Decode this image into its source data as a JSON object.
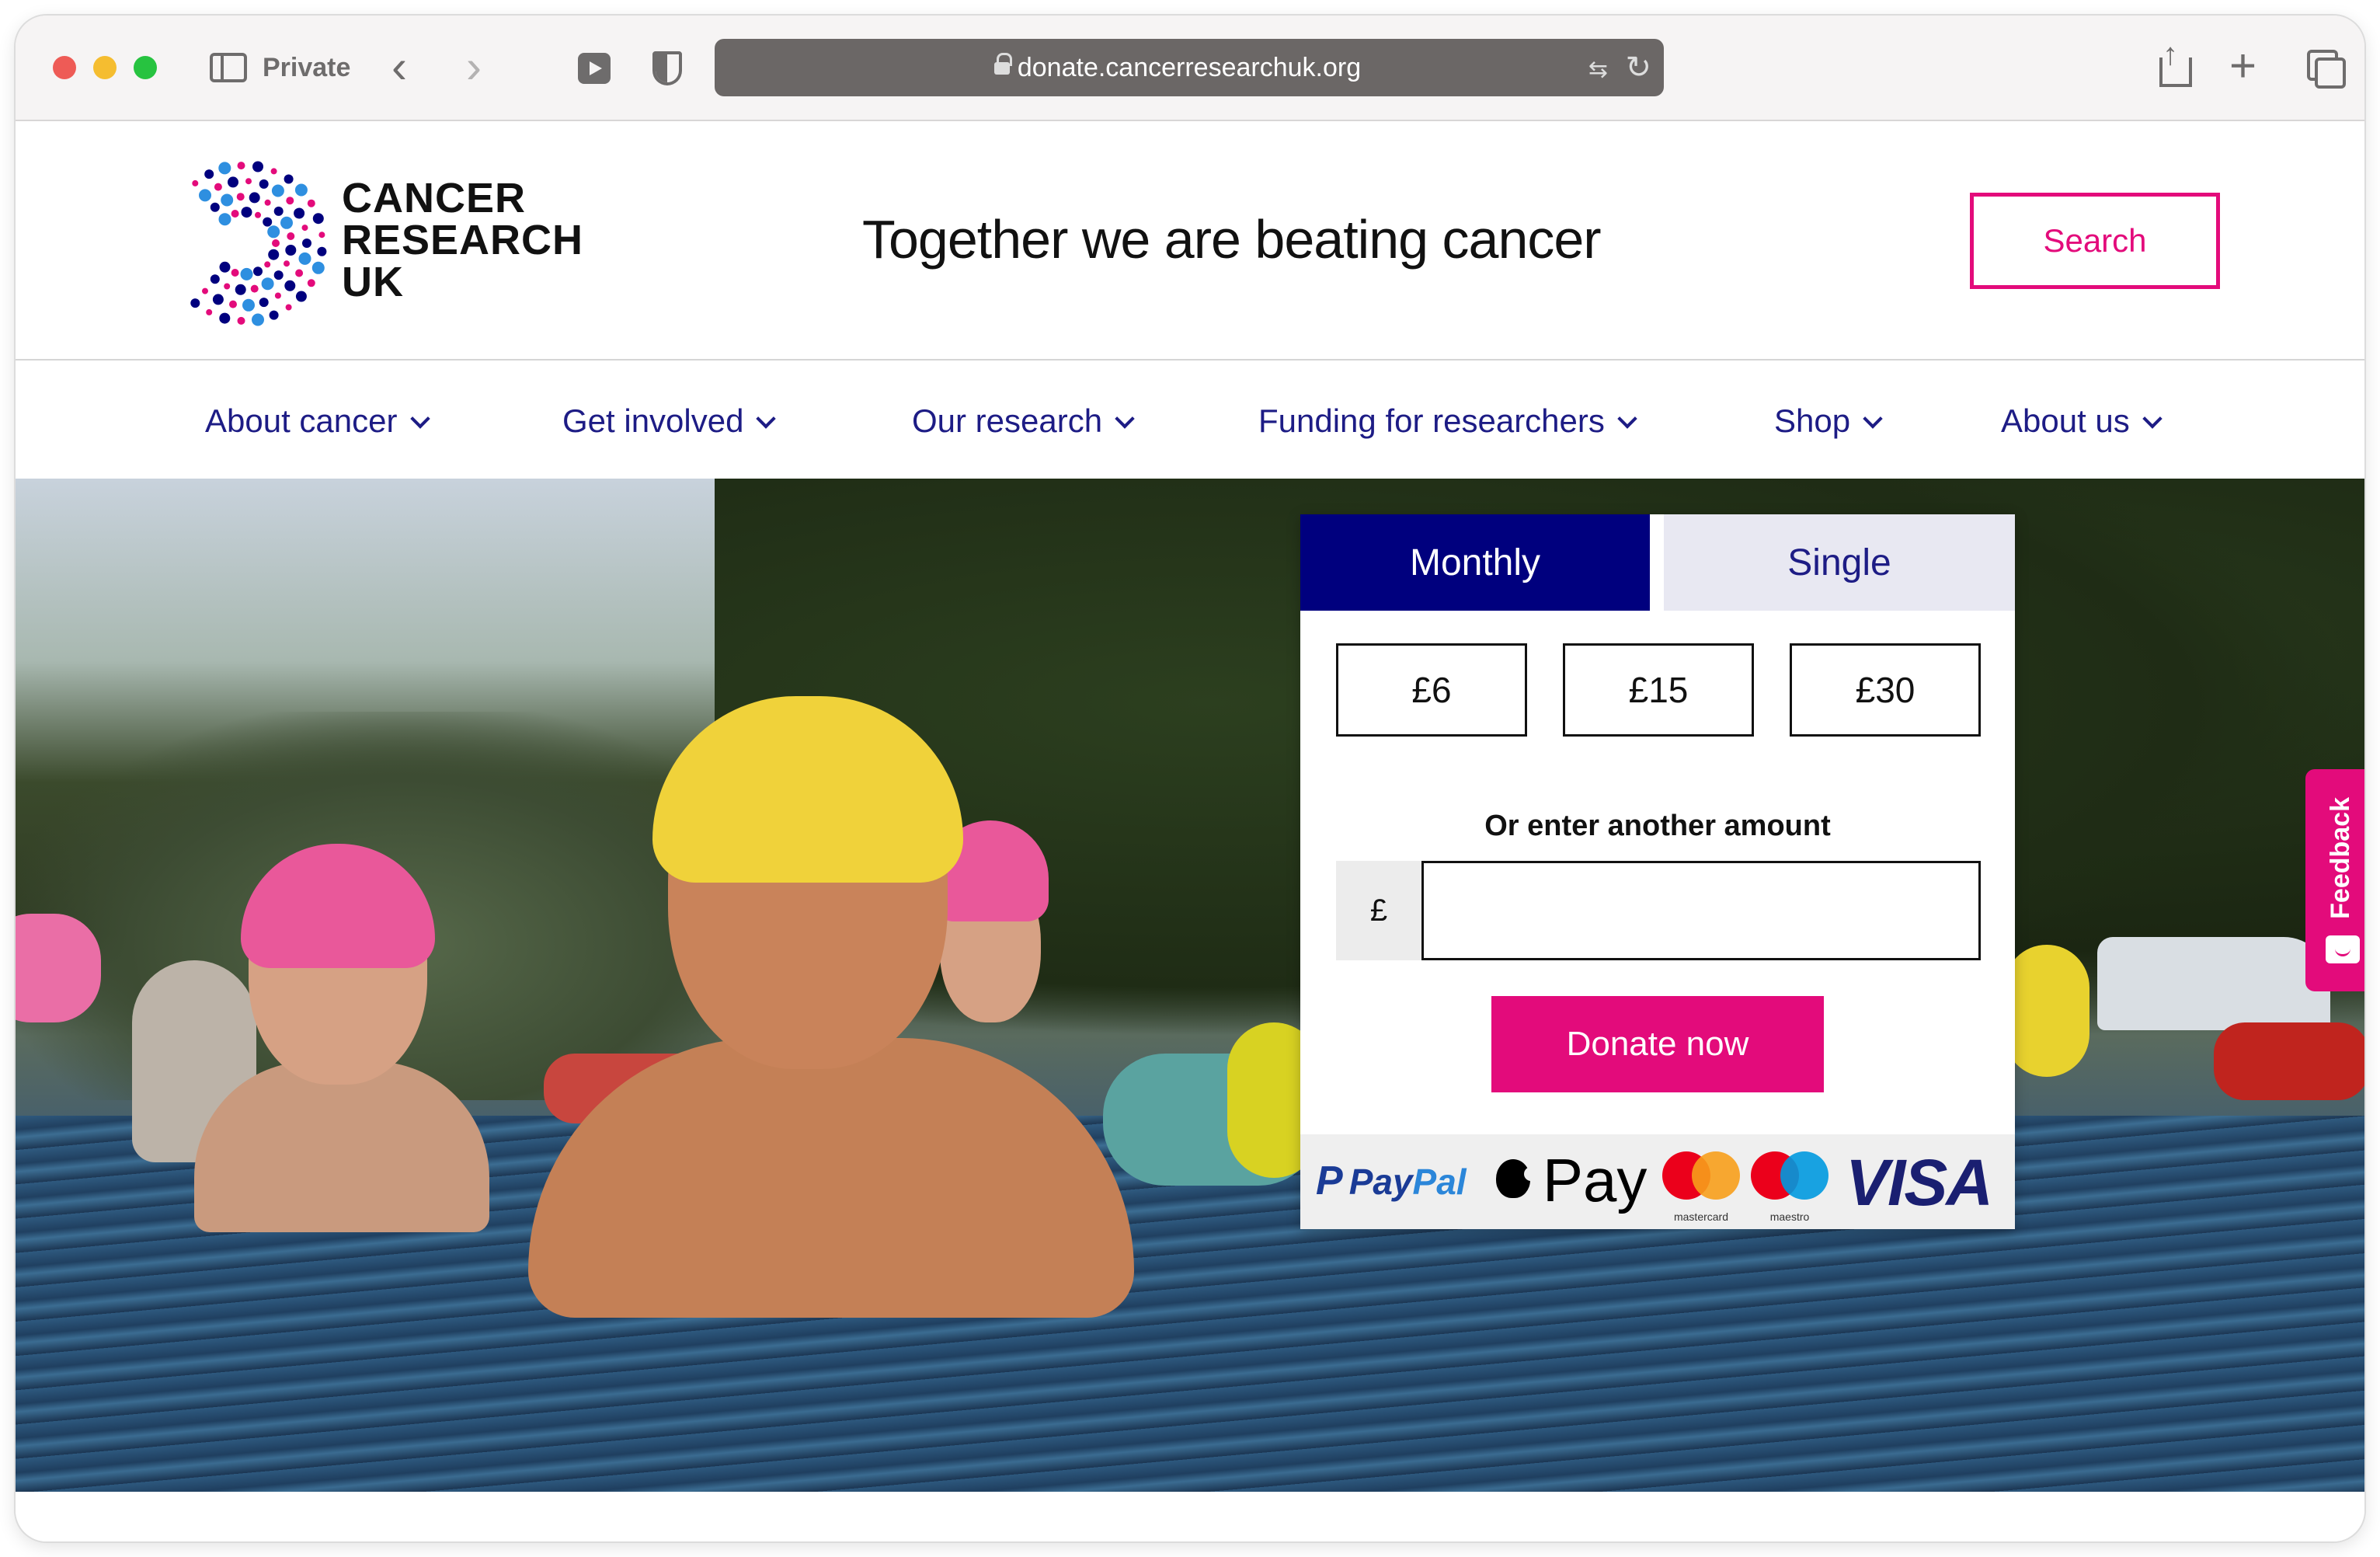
{
  "browser": {
    "mode_label": "Private",
    "url": "donate.cancerresearchuk.org",
    "icons": [
      "sidebar-icon",
      "back-arrow-icon",
      "forward-arrow-icon",
      "media-extension-icon",
      "privacy-shield-icon",
      "lock-icon",
      "translate-icon",
      "reload-icon",
      "share-icon",
      "new-tab-icon",
      "tab-overview-icon"
    ]
  },
  "header": {
    "logo_lines": [
      "CANCER",
      "RESEARCH",
      "UK"
    ],
    "tagline": "Together we are beating cancer",
    "search_label": "Search"
  },
  "nav": {
    "items": [
      {
        "label": "About cancer"
      },
      {
        "label": "Get involved"
      },
      {
        "label": "Our research"
      },
      {
        "label": "Funding for researchers"
      },
      {
        "label": "Shop"
      },
      {
        "label": "About us"
      }
    ]
  },
  "donation": {
    "tabs": [
      {
        "label": "Monthly",
        "selected": true
      },
      {
        "label": "Single",
        "selected": false
      }
    ],
    "amounts": [
      "£6",
      "£15",
      "£30"
    ],
    "other_amount_label": "Or enter another amount",
    "currency_symbol": "£",
    "amount_value": "",
    "donate_label": "Donate now",
    "payment_methods": {
      "paypal_pay": "Pay",
      "paypal_pal": "Pal",
      "apple_pay": "Pay",
      "mastercard": "mastercard",
      "maestro": "maestro",
      "visa": "VISA"
    }
  },
  "feedback": {
    "label": "Feedback"
  },
  "colors": {
    "brand_pink": "#e30b7b",
    "brand_navy": "#00007e",
    "nav_text": "#1d1c85"
  }
}
